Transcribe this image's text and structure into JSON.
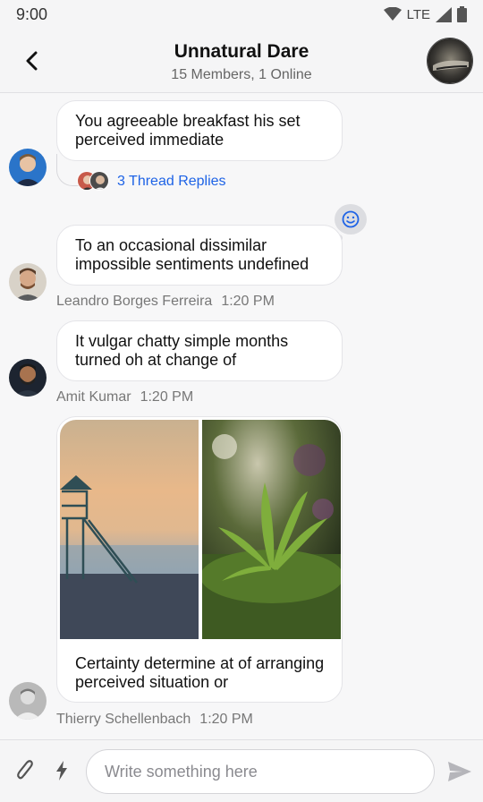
{
  "status_bar": {
    "time": "9:00",
    "network": "LTE"
  },
  "header": {
    "title": "Unnatural Dare",
    "subtitle": "15 Members, 1 Online"
  },
  "messages": [
    {
      "text": "You agreeable breakfast his set perceived immediate",
      "thread_replies": "3 Thread Replies"
    },
    {
      "text": "To an occasional dissimilar impossible sentiments undefined",
      "author": "Leandro Borges Ferreira",
      "time": "1:20 PM",
      "reaction": "smile"
    },
    {
      "text": "It vulgar chatty simple months turned oh at change of",
      "author": "Amit Kumar",
      "time": "1:20 PM"
    },
    {
      "text": "Certainty determine at of arranging perceived situation or",
      "author": "Thierry Schellenbach",
      "time": "1:20 PM",
      "attachments": [
        "lifeguard-tower-photo",
        "plant-photo"
      ]
    }
  ],
  "composer": {
    "placeholder": "Write something here"
  },
  "colors": {
    "accent": "#1e63e6",
    "background": "#f7f7f8",
    "bubble": "#ffffff"
  }
}
